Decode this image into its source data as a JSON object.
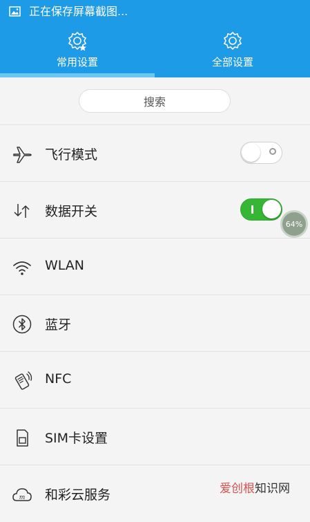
{
  "status_bar": {
    "text": "正在保存屏幕截图..."
  },
  "tabs": [
    {
      "label": "常用设置",
      "icon": "gear-star-icon",
      "selected": true
    },
    {
      "label": "全部设置",
      "icon": "gear-icon",
      "selected": false
    }
  ],
  "search": {
    "label": "搜索"
  },
  "settings": [
    {
      "label": "飞行模式",
      "icon": "airplane-icon",
      "toggle": "off"
    },
    {
      "label": "数据开关",
      "icon": "data-transfer-icon",
      "toggle": "on"
    },
    {
      "label": "WLAN",
      "icon": "wifi-icon"
    },
    {
      "label": "蓝牙",
      "icon": "bluetooth-icon"
    },
    {
      "label": "NFC",
      "icon": "nfc-icon"
    },
    {
      "label": "SIM卡设置",
      "icon": "sim-card-icon"
    },
    {
      "label": "和彩云服务",
      "icon": "cloud-icon"
    }
  ],
  "floating_badge": {
    "text": "64%"
  },
  "watermark": {
    "part1": "爱创根",
    "part2": "知识网"
  },
  "colors": {
    "header": "#1d9be6",
    "tab_indicator": "#6bc8f5",
    "toggle_on": "#35b635",
    "watermark_red": "#d9534f"
  }
}
